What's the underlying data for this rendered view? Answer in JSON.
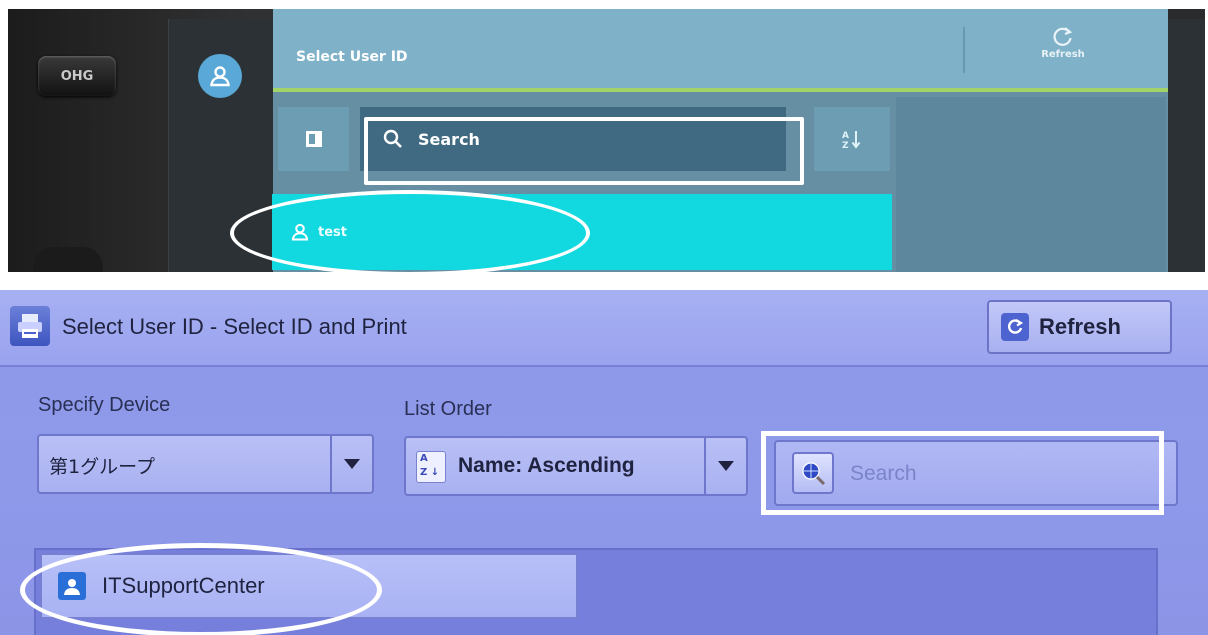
{
  "top_screen": {
    "hw_button_label": "OHG",
    "title": "Select User ID",
    "refresh_label": "Refresh",
    "search_placeholder": "Search",
    "user_row_label": "test",
    "colors": {
      "header": "#7fb2c8",
      "accent_line": "#a3d46a",
      "selected_row": "#12d8e0"
    }
  },
  "bottom_screen": {
    "title": "Select User ID - Select ID and Print",
    "refresh_label": "Refresh",
    "specify_device_label": "Specify Device",
    "specify_device_value": "第1グループ",
    "list_order_label": "List Order",
    "list_order_value": "Name: Ascending",
    "search_placeholder": "Search",
    "user_row_label": "ITSupportCenter",
    "colors": {
      "background": "#8e9ae8",
      "user_icon": "#2a6fd8"
    }
  }
}
